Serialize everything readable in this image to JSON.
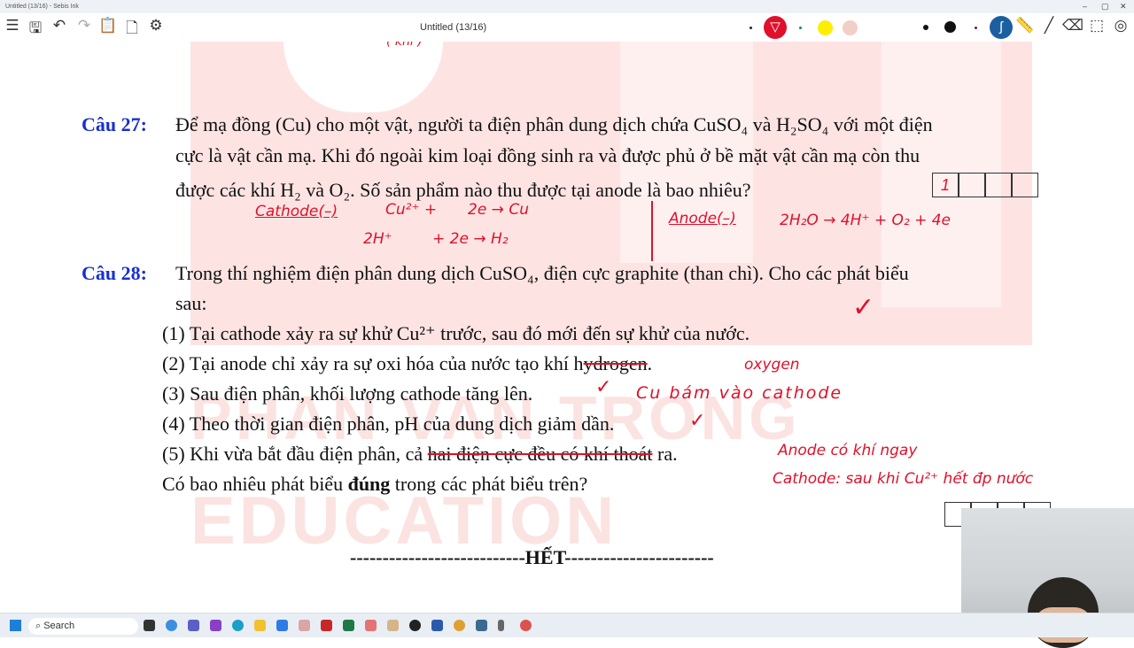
{
  "window": {
    "title": "Untitled (13/16) - Sebis Ink",
    "min": "–",
    "max": "▢",
    "close": "✕"
  },
  "toolbar": {
    "doc_title": "Untitled (13/16)",
    "pen_color": "#e0102a",
    "highlighter_color": "#ffee00",
    "accent": "#1b5fa0"
  },
  "q27": {
    "label": "Câu 27:",
    "lines": [
      "Để mạ đồng (Cu) cho một vật, người ta điện phân dung dịch chứa CuSO₄ và H₂SO₄ với một điện",
      "cực là vật cần mạ. Khi đó ngoài kim loại đồng sinh ra và được phủ ở bề mặt vật cần mạ còn thu",
      "được các khí H₂ và O₂. Số sản phẩm nào thu được tại anode là bao nhiêu?"
    ],
    "answer": "1"
  },
  "q28": {
    "label": "Câu 28:",
    "lines": [
      "Trong thí nghiệm điện phân dung dịch CuSO₄, điện cực graphite (than chì). Cho các phát biểu",
      "sau:"
    ],
    "s1": "(1) Tại cathode xảy ra sự khử Cu²⁺ trước, sau đó mới đến sự khử của nước.",
    "s2a": "(2) Tại anode chỉ xảy ra sự oxi hóa của nước tạo khí h",
    "s2b": "ydrogen",
    ".": ".",
    "s2c": ".",
    "s3": "(3) Sau điện phân, khối lượng cathode tăng lên.",
    "s4": "(4) Theo thời gian điện phân, pH của dung dịch giảm dần.",
    "s5a": "(5) Khi vừa bắt đầu điện phân, cả ",
    "s5b": "hai điện cực đều có khí thoát",
    "s5c": " ra.",
    "question_a": "Có bao nhiêu phát biểu ",
    "question_b": "đúng",
    "question_c": " trong các phát biểu trên?"
  },
  "end": "---------------------------HẾT-----------------------",
  "ink": {
    "top": "( khí )",
    "cathode": "Cathode(–)",
    "c1": "Cu²⁺ +",
    "c2": "2e → Cu",
    "c3": "2H⁺",
    "c4": "+ 2e → H₂",
    "anode": "Anode(–)",
    "a1": "2H₂O → 4H⁺ + O₂ + 4e",
    "check": "✓",
    "oxygen": "oxygen",
    "cu": "Cu bám vào cathode",
    "anode_note": "Anode có khí ngay",
    "cathode_note": "Cathode: sau khi Cu²⁺ hết đp nước"
  },
  "watermark": {
    "line1": "PHAN VAN TRONG",
    "line2": "EDUCATION"
  },
  "taskbar": {
    "search": "Search"
  }
}
